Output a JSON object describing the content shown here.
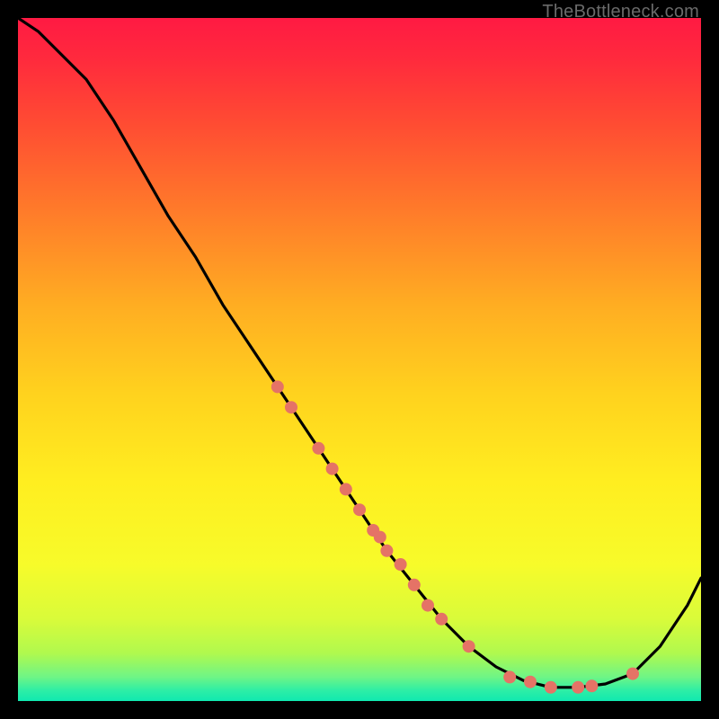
{
  "watermark": "TheBottleneck.com",
  "chart_data": {
    "type": "line",
    "title": "",
    "xlabel": "",
    "ylabel": "",
    "xlim": [
      0,
      100
    ],
    "ylim": [
      0,
      100
    ],
    "grid": false,
    "series": [
      {
        "name": "curve",
        "x": [
          0,
          3,
          6,
          10,
          14,
          18,
          22,
          26,
          30,
          34,
          38,
          42,
          46,
          50,
          54,
          58,
          62,
          66,
          70,
          74,
          78,
          82,
          86,
          90,
          94,
          98,
          100
        ],
        "values": [
          100,
          98,
          95,
          91,
          85,
          78,
          71,
          65,
          58,
          52,
          46,
          40,
          34,
          28,
          22,
          17,
          12,
          8,
          5,
          3,
          2,
          2,
          2.5,
          4,
          8,
          14,
          18
        ]
      }
    ],
    "markers": {
      "name": "highlighted-points",
      "color": "#e57366",
      "x": [
        38,
        40,
        44,
        46,
        48,
        50,
        52,
        53,
        54,
        56,
        58,
        60,
        62,
        66,
        72,
        75,
        78,
        82,
        84,
        90
      ],
      "values": [
        46,
        43,
        37,
        34,
        31,
        28,
        25,
        24,
        22,
        20,
        17,
        14,
        12,
        8,
        3.5,
        2.8,
        2,
        2,
        2.2,
        4
      ]
    },
    "gradient_stops": [
      {
        "offset": 0.0,
        "color": "#ff1a43"
      },
      {
        "offset": 0.06,
        "color": "#ff2a3d"
      },
      {
        "offset": 0.15,
        "color": "#ff4a33"
      },
      {
        "offset": 0.28,
        "color": "#ff7a2a"
      },
      {
        "offset": 0.42,
        "color": "#ffad22"
      },
      {
        "offset": 0.55,
        "color": "#ffd21e"
      },
      {
        "offset": 0.68,
        "color": "#ffee20"
      },
      {
        "offset": 0.8,
        "color": "#f7fb2a"
      },
      {
        "offset": 0.88,
        "color": "#d9fb3a"
      },
      {
        "offset": 0.93,
        "color": "#b0f94e"
      },
      {
        "offset": 0.965,
        "color": "#6ef586"
      },
      {
        "offset": 0.985,
        "color": "#2ceea6"
      },
      {
        "offset": 1.0,
        "color": "#10e9b0"
      }
    ]
  }
}
